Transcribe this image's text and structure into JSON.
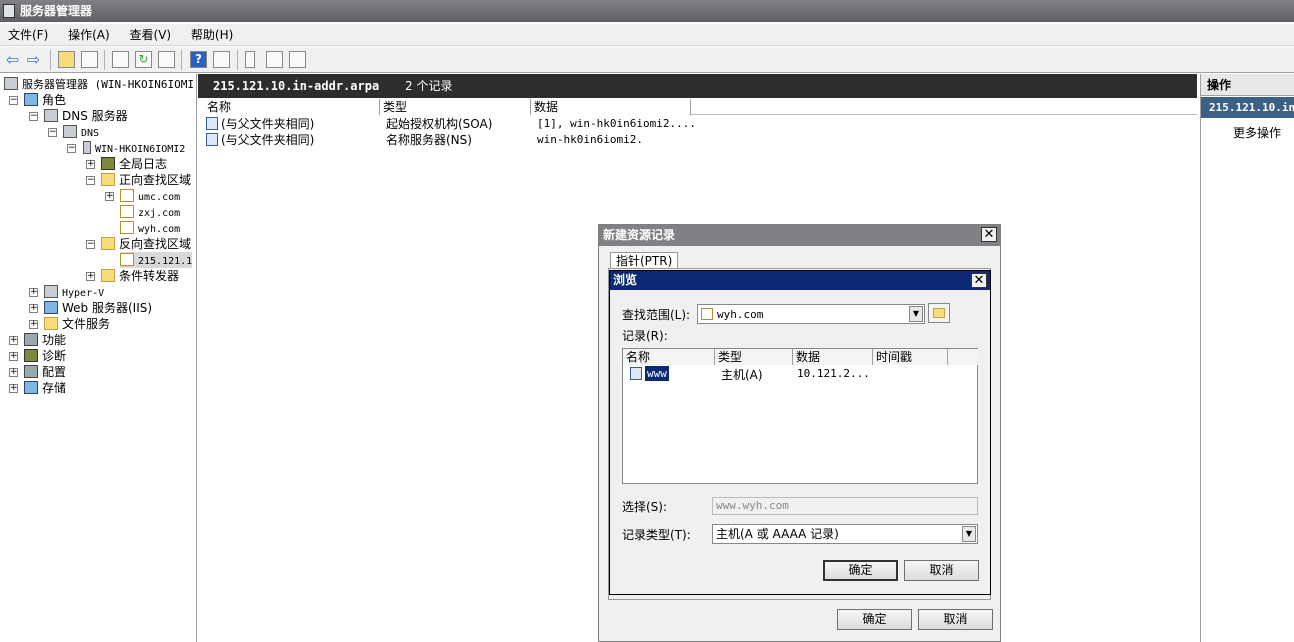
{
  "window": {
    "title": "服务器管理器"
  },
  "menu": [
    "文件(F)",
    "操作(A)",
    "查看(V)",
    "帮助(H)"
  ],
  "tree": {
    "root": "服务器管理器 (WIN-HKOIN6IOMI",
    "roles": "角色",
    "dns_server": "DNS 服务器",
    "dns": "DNS",
    "host": "WIN-HKOIN6IOMI2",
    "global_log": "全局日志",
    "forward_zones": "正向查找区域",
    "zone1": "umc.com",
    "zone2": "zxj.com",
    "zone3": "wyh.com",
    "reverse_zones": "反向查找区域",
    "reverse_zone1": "215.121.1",
    "conditional": "条件转发器",
    "hyperv": "Hyper-V",
    "iis": "Web 服务器(IIS)",
    "file_services": "文件服务",
    "features": "功能",
    "diagnostics": "诊断",
    "config": "配置",
    "storage": "存储"
  },
  "center": {
    "zone_title": "215.121.10.in-addr.arpa",
    "record_count": "2 个记录",
    "columns": [
      "名称",
      "类型",
      "数据"
    ],
    "rows": [
      {
        "name": "(与父文件夹相同)",
        "type": "起始授权机构(SOA)",
        "data": "[1], win-hk0in6iomi2...."
      },
      {
        "name": "(与父文件夹相同)",
        "type": "名称服务器(NS)",
        "data": "win-hk0in6iomi2."
      }
    ]
  },
  "actions": {
    "header": "操作",
    "zone": "215.121.10.in",
    "more": "更多操作"
  },
  "new_record_dialog": {
    "title": "新建资源记录",
    "tab": "指针(PTR)",
    "ok": "确定",
    "cancel": "取消"
  },
  "browse_dialog": {
    "title": "浏览",
    "scope_label": "查找范围(L):",
    "scope_value": "wyh.com",
    "records_label": "记录(R):",
    "columns": [
      "名称",
      "类型",
      "数据",
      "时间戳"
    ],
    "record": {
      "name": "www",
      "type": "主机(A)",
      "data": "10.121.2..."
    },
    "select_label": "选择(S):",
    "select_value": "www.wyh.com",
    "record_type_label": "记录类型(T):",
    "record_type_value": "主机(A 或 AAAA 记录)",
    "ok": "确定",
    "cancel": "取消"
  }
}
